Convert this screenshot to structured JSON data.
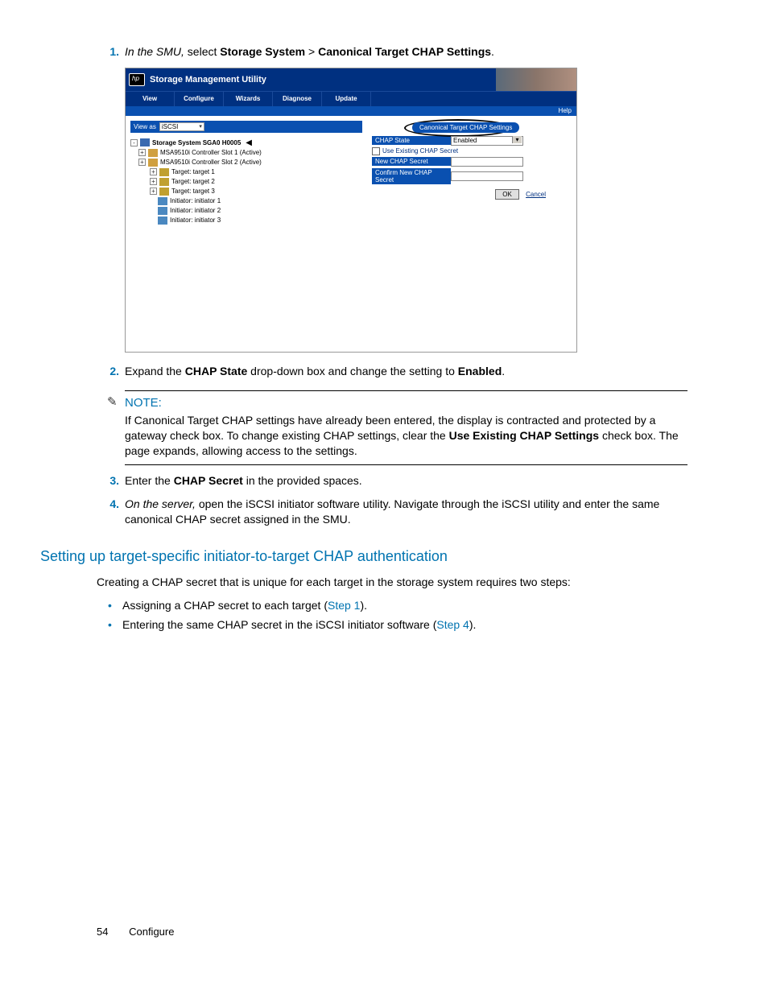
{
  "step1": {
    "prefix_italic": "In the SMU,",
    "mid": " select ",
    "b1": "Storage System",
    "gt": " > ",
    "b2": "Canonical Target CHAP Settings",
    "suffix": "."
  },
  "smu": {
    "title": "Storage Management Utility",
    "menus": [
      "View",
      "Configure",
      "Wizards",
      "Diagnose",
      "Update"
    ],
    "help": "Help",
    "view_as_label": "View as",
    "view_as_value": "iSCSI",
    "tree": {
      "root": "Storage System SGA0 H0005",
      "ctrl1": "MSA9510i Controller Slot 1 (Active)",
      "ctrl2": "MSA9510i Controller Slot 2 (Active)",
      "t1": "Target: target 1",
      "t2": "Target: target 2",
      "t3": "Target: target 3",
      "i1": "Initiator: initiator 1",
      "i2": "Initiator: initiator 2",
      "i3": "Initiator: initiator 3"
    },
    "panel": {
      "title": "Canonical Target CHAP Settings",
      "row1_label": "CHAP State",
      "row1_value": "Enabled",
      "chk_label": "Use Existing CHAP Secret",
      "row2_label": "New CHAP Secret",
      "row3_label": "Confirm New CHAP Secret",
      "ok": "OK",
      "cancel": "Cancel"
    }
  },
  "step2": {
    "a": "Expand the ",
    "b1": "CHAP State",
    "b": " drop-down box and change the setting to ",
    "b2": "Enabled",
    "c": "."
  },
  "note": {
    "title": "NOTE:",
    "body_a": "If Canonical Target CHAP settings have already been entered, the display is contracted and protected by a gateway check box. To change existing CHAP settings, clear the ",
    "body_b1": "Use Existing CHAP Settings",
    "body_c": " check box. The page expands, allowing access to the settings."
  },
  "step3": {
    "a": "Enter the ",
    "b1": "CHAP Secret",
    "b": " in the provided spaces."
  },
  "step4": {
    "italic": "On the server,",
    "rest": " open the iSCSI initiator software utility. Navigate through the iSCSI utility and enter the same canonical CHAP secret assigned in the SMU."
  },
  "section_title": "Setting up target-specific initiator-to-target CHAP authentication",
  "section_para": "Creating a CHAP secret that is unique for each target in the storage system requires two steps:",
  "bullets": {
    "b1a": "Assigning a CHAP secret to each target (",
    "b1link": "Step 1",
    "b1c": ").",
    "b2a": "Entering the same CHAP secret in the iSCSI initiator software (",
    "b2link": "Step 4",
    "b2c": ")."
  },
  "footer": {
    "page": "54",
    "section": "Configure"
  }
}
